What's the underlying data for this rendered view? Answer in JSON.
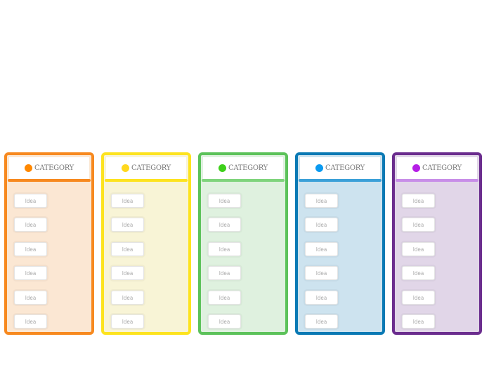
{
  "columns": [
    {
      "title": "CATEGORY",
      "border": "#f7891f",
      "background": "#fbe7d3",
      "underline": "#f7891f",
      "dot": "#ff8800",
      "ideas": [
        "Idea",
        "Idea",
        "Idea",
        "Idea",
        "Idea",
        "Idea"
      ]
    },
    {
      "title": "CATEGORY",
      "border": "#fde31f",
      "background": "#f8f4d6",
      "underline": "#fde31f",
      "dot": "#ffd81e",
      "ideas": [
        "Idea",
        "Idea",
        "Idea",
        "Idea",
        "Idea",
        "Idea"
      ]
    },
    {
      "title": "CATEGORY",
      "border": "#5cc25a",
      "background": "#dff1df",
      "underline": "#7fd47c",
      "dot": "#3ed01a",
      "ideas": [
        "Idea",
        "Idea",
        "Idea",
        "Idea",
        "Idea",
        "Idea"
      ]
    },
    {
      "title": "CATEGORY",
      "border": "#0a79b4",
      "background": "#cde3ef",
      "underline": "#3ba0d8",
      "dot": "#0a9af0",
      "ideas": [
        "Idea",
        "Idea",
        "Idea",
        "Idea",
        "Idea",
        "Idea"
      ]
    },
    {
      "title": "CATEGORY",
      "border": "#6b2d8e",
      "background": "#e1d6e8",
      "underline": "#c88ee8",
      "dot": "#b51ee6",
      "ideas": [
        "Idea",
        "Idea",
        "Idea",
        "Idea",
        "Idea",
        "Idea"
      ]
    }
  ]
}
